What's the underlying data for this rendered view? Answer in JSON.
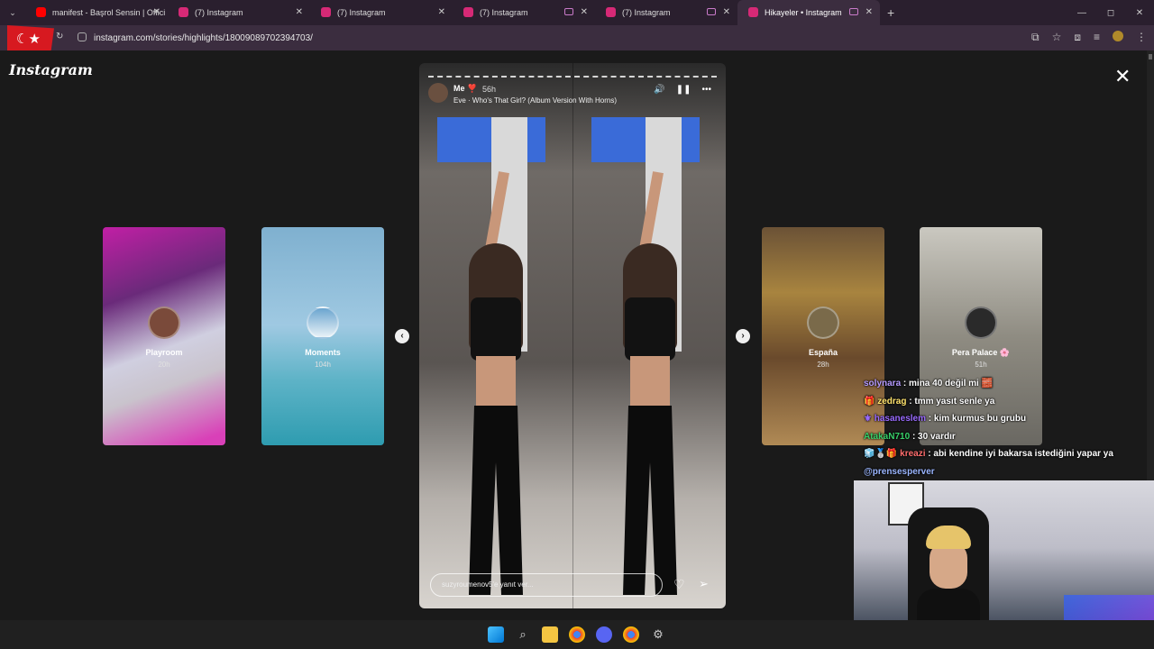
{
  "browser": {
    "tabs": [
      {
        "title": "manifest - Başrol Sensin | Offici",
        "favicon_color": "#ff0000",
        "media": false
      },
      {
        "title": "(7) Instagram",
        "favicon_color": "#d62976",
        "media": false
      },
      {
        "title": "(7) Instagram",
        "favicon_color": "#d62976",
        "media": false
      },
      {
        "title": "(7) Instagram",
        "favicon_color": "#d62976",
        "media": true
      },
      {
        "title": "(7) Instagram",
        "favicon_color": "#d62976",
        "media": true
      },
      {
        "title": "Hikayeler • Instagram",
        "favicon_color": "#d62976",
        "media": true
      }
    ],
    "url": "instagram.com/stories/highlights/18009089702394703/",
    "new_tab": "+",
    "window_controls": {
      "minimize": "—",
      "maximize": "◻",
      "close": "✕"
    }
  },
  "page": {
    "brand": "Instagram",
    "close_icon": "✕",
    "side_stories": [
      {
        "name": "Playroom",
        "age": "20h"
      },
      {
        "name": "Moments",
        "age": "104h"
      },
      {
        "name": "España",
        "age": "28h"
      },
      {
        "name": "Pera Palace 🌸",
        "age": "51h"
      }
    ],
    "prev": "‹",
    "next": "›",
    "story": {
      "user": "Me ❣️",
      "time": "56h",
      "song": "Eve · Who's That Girl? (Album Version With Horns)",
      "reply_placeholder": "suzyroumenov5'e yanıt ver...",
      "controls": {
        "sound": "🔊",
        "pause": "❚❚",
        "more": "•••"
      },
      "like": "♡",
      "share": "➢"
    }
  },
  "chat": [
    {
      "user": "solynara",
      "message": ": mina 40 değil mi 🧱"
    },
    {
      "user": "🎁 zedrag",
      "message": ": tmm yasıt senle ya"
    },
    {
      "user": "⚜ hasaneslem",
      "message": ": kim kurmus bu grubu"
    },
    {
      "user": "AtakaN710",
      "message": ": 30 vardır"
    },
    {
      "user": "🧊🥈🎁 kreazi",
      "message": ": abi kendine iyi bakarsa istediğini yapar ya"
    }
  ],
  "chat_mention": "@prensesperver",
  "taskbar": {
    "start": "",
    "search": "⌕",
    "files": "",
    "chrome": "",
    "discord": "",
    "settings": "⚙"
  }
}
